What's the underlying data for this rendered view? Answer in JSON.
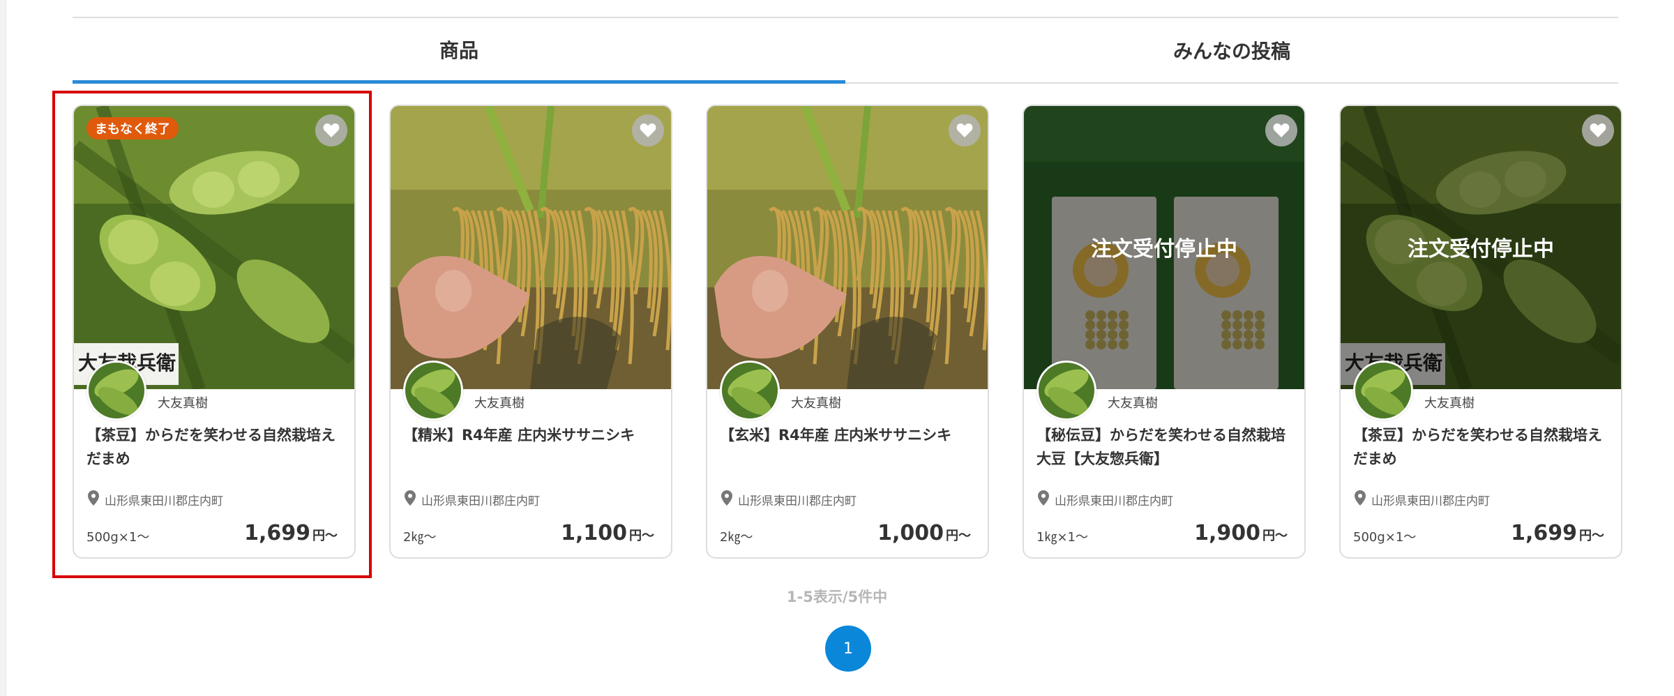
{
  "tabs": [
    {
      "label": "商品",
      "active": true
    },
    {
      "label": "みんなの投稿",
      "active": false
    }
  ],
  "products": [
    {
      "badge": "まもなく終了",
      "stop_text": "",
      "seller": "大友真樹",
      "title": "【茶豆】からだを笑わせる自然栽培えだまめ",
      "location": "山形県東田川郡庄内町",
      "spec": "500g×1～",
      "price": "1,699",
      "price_suffix": "円～",
      "image": "edamame",
      "photo_text": "大友栽兵衛"
    },
    {
      "badge": "",
      "stop_text": "",
      "seller": "大友真樹",
      "title": "【精米】R4年産 庄内米ササニシキ",
      "location": "山形県東田川郡庄内町",
      "spec": "2㎏～",
      "price": "1,100",
      "price_suffix": "円～",
      "image": "rice"
    },
    {
      "badge": "",
      "stop_text": "",
      "seller": "大友真樹",
      "title": "【玄米】R4年産 庄内米ササニシキ",
      "location": "山形県東田川郡庄内町",
      "spec": "2㎏～",
      "price": "1,000",
      "price_suffix": "円～",
      "image": "rice"
    },
    {
      "badge": "",
      "stop_text": "注文受付停止中",
      "seller": "大友真樹",
      "title": "【秘伝豆】からだを笑わせる自然栽培大豆【大友惣兵衛】",
      "location": "山形県東田川郡庄内町",
      "spec": "1㎏×1～",
      "price": "1,900",
      "price_suffix": "円～",
      "image": "soybeans"
    },
    {
      "badge": "",
      "stop_text": "注文受付停止中",
      "seller": "大友真樹",
      "title": "【茶豆】からだを笑わせる自然栽培えだまめ",
      "location": "山形県東田川郡庄内町",
      "spec": "500g×1～",
      "price": "1,699",
      "price_suffix": "円～",
      "image": "edamame",
      "photo_text": "大友栽兵衛"
    }
  ],
  "pagination": {
    "summary": "1-5表示/5件中",
    "current_page": "1"
  },
  "colors": {
    "tab_active_underline": "#2a8bd9",
    "badge": "#e05a0c",
    "page_button": "#0a87d9",
    "selection_outline": "#d80000"
  }
}
